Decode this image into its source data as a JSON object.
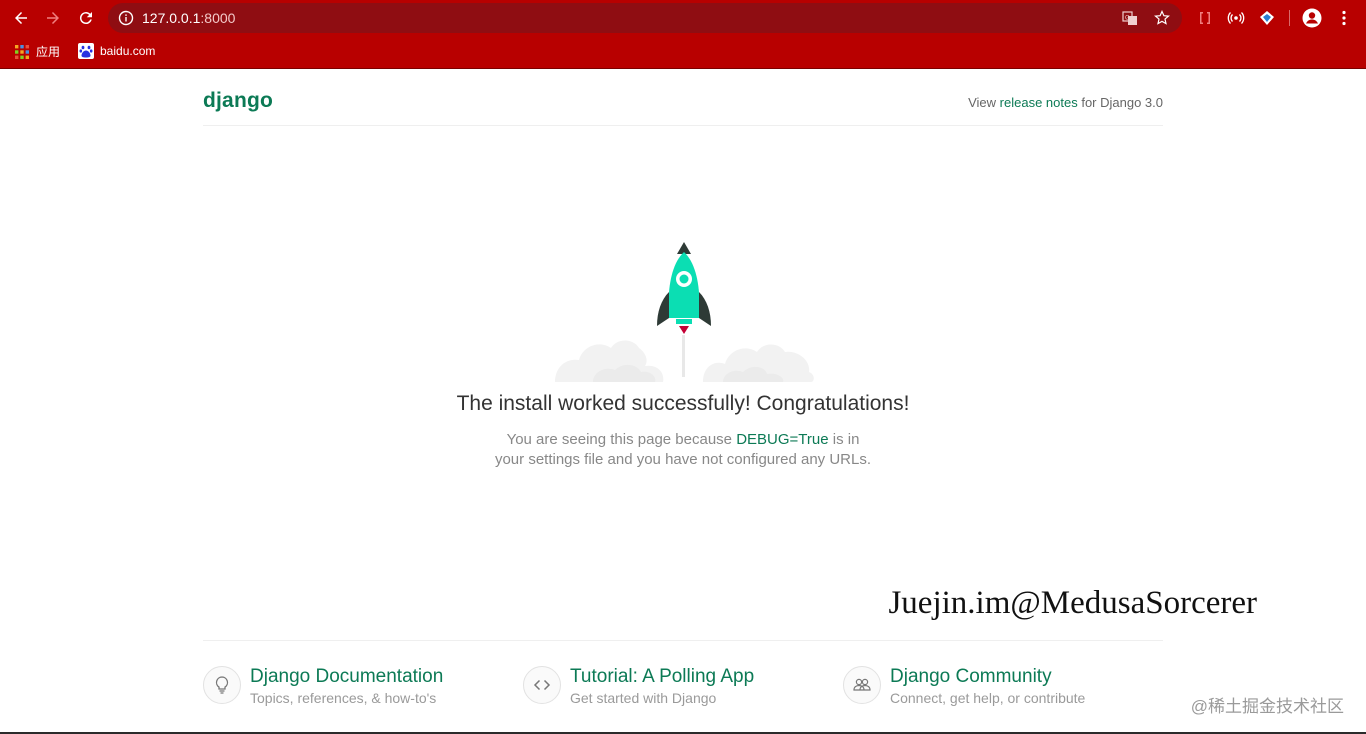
{
  "browser": {
    "url_host": "127.0.0.1",
    "url_port": ":8000",
    "bookmarks": [
      {
        "label": "应用",
        "icon": "apps-grid-icon"
      },
      {
        "label": "baidu.com",
        "icon": "baidu-paw-icon"
      }
    ],
    "colors": {
      "chrome": "#b80000",
      "omnibox": "#8f0d12"
    }
  },
  "page": {
    "logo": "django",
    "release": {
      "prefix": "View ",
      "link": "release notes",
      "suffix": " for Django 3.0"
    },
    "headline": "The install worked successfully! Congratulations!",
    "sub": {
      "prefix": "You are seeing this page because ",
      "debug": "DEBUG=True",
      "suffix": " is in your settings file and you have not configured any URLs."
    },
    "cards": [
      {
        "title": "Django Documentation",
        "desc": "Topics, references, & how-to's",
        "icon": "lightbulb-icon"
      },
      {
        "title": "Tutorial: A Polling App",
        "desc": "Get started with Django",
        "icon": "code-brackets-icon"
      },
      {
        "title": "Django Community",
        "desc": "Connect, get help, or contribute",
        "icon": "people-icon"
      }
    ],
    "colors": {
      "brand": "#0c7a55",
      "rocket": "#0bdeb3"
    }
  },
  "watermarks": {
    "author": "Juejin.im@MedusaSorcerer",
    "site": "@稀土掘金技术社区"
  }
}
